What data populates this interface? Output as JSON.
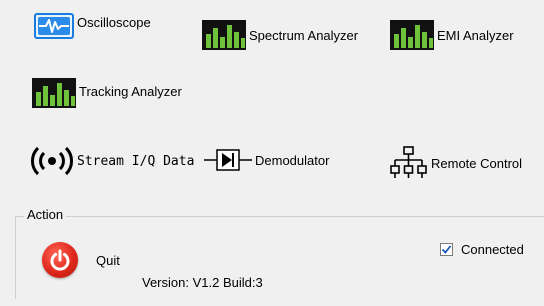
{
  "tools": {
    "oscilloscope": "Oscilloscope",
    "spectrum_analyzer": "Spectrum Analyzer",
    "emi_analyzer": "EMI Analyzer",
    "tracking_analyzer": "Tracking Analyzer",
    "stream_iq": "Stream I/Q Data",
    "demodulator": "Demodulator",
    "remote_control": "Remote Control"
  },
  "icons": {
    "oscilloscope": "oscilloscope-icon",
    "spectrum": "spectrum-bars-icon",
    "stream": "broadcast-icon",
    "demodulator": "diode-icon",
    "remote": "network-icon",
    "quit": "power-icon"
  },
  "action": {
    "title": "Action",
    "quit_label": "Quit",
    "version": "Version: V1.2 Build:3",
    "connected_label": "Connected",
    "connected_checked": true
  },
  "colors": {
    "accent_blue": "#1b7ce0",
    "bar_green": "#6fc33b",
    "quit_red": "#e0261a"
  }
}
